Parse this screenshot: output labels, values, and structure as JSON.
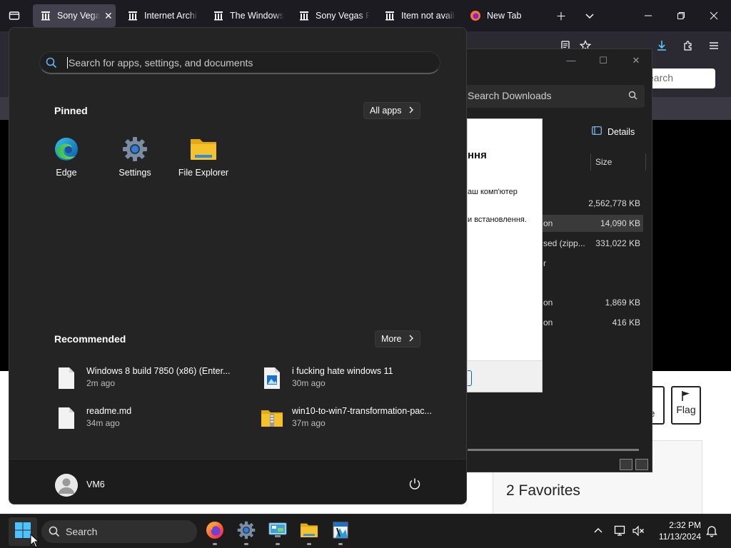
{
  "browser": {
    "tabs": [
      {
        "label": "Sony Vegas",
        "active": true,
        "icon": "archive-icon",
        "closable": true
      },
      {
        "label": "Internet Archi",
        "active": false,
        "icon": "archive-icon"
      },
      {
        "label": "The Windows",
        "active": false,
        "icon": "archive-icon"
      },
      {
        "label": "Sony Vegas Pr",
        "active": false,
        "icon": "archive-icon"
      },
      {
        "label": "Item not avail",
        "active": false,
        "icon": "archive-icon"
      },
      {
        "label": "New Tab",
        "active": false,
        "icon": "firefox-icon"
      }
    ],
    "page_search_placeholder": "earch",
    "flag_label": "Flag",
    "share_partial_label": "re",
    "favorites_title": "2 Favorites"
  },
  "downloads": {
    "search_placeholder": "Search Downloads",
    "details_label": "Details",
    "size_header": "Size",
    "rows": [
      {
        "name": "",
        "size": "2,562,778 KB"
      },
      {
        "name": "on",
        "size": "14,090 KB"
      },
      {
        "name": "sed (zipp...",
        "size": "331,022 KB"
      },
      {
        "name": "r",
        "size": ""
      },
      {
        "name": "on",
        "size": "1,869 KB"
      },
      {
        "name": "on",
        "size": "416 KB"
      }
    ]
  },
  "installer_dialog": {
    "title_partial": "ння",
    "line1_partial": "аш комп'ютер",
    "line2_partial": "и встановлення."
  },
  "start_menu": {
    "search_placeholder": "Search for apps, settings, and documents",
    "pinned_title": "Pinned",
    "all_apps_label": "All apps",
    "pinned_apps": [
      {
        "label": "Edge",
        "icon": "edge-icon"
      },
      {
        "label": "Settings",
        "icon": "settings-gear-icon"
      },
      {
        "label": "File Explorer",
        "icon": "folder-icon"
      }
    ],
    "recommended_title": "Recommended",
    "more_label": "More",
    "recommended": [
      {
        "name": "Windows 8 build 7850 (x86) (Enter...",
        "time": "2m ago",
        "icon": "file-icon"
      },
      {
        "name": "i fucking hate windows 11",
        "time": "30m ago",
        "icon": "image-file-icon"
      },
      {
        "name": "readme.md",
        "time": "34m ago",
        "icon": "file-icon"
      },
      {
        "name": "win10-to-win7-transformation-pac...",
        "time": "37m ago",
        "icon": "zip-folder-icon"
      }
    ],
    "user_name": "VM6"
  },
  "taskbar": {
    "search_label": "Search",
    "apps": [
      "firefox-icon",
      "settings-gear-icon",
      "control-panel-icon",
      "file-explorer-icon",
      "installer-icon"
    ],
    "time": "2:32 PM",
    "date": "11/13/2024"
  },
  "colors": {
    "start_bg": "#242424",
    "taskbar_bg": "#1c1c1c",
    "accent_blue": "#0078d4",
    "folder_yellow": "#f6c22c"
  }
}
